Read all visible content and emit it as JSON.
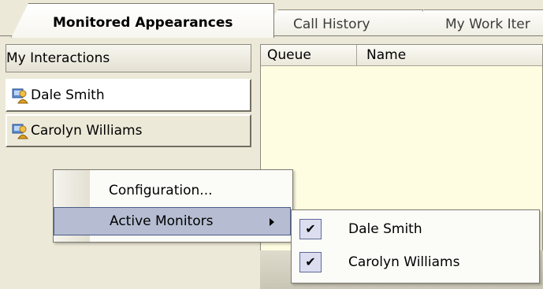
{
  "tabs": [
    {
      "label": "Monitored Appearances",
      "active": true
    },
    {
      "label": "Call History",
      "active": false
    },
    {
      "label": "My Work Iter",
      "active": false
    }
  ],
  "left_panel": {
    "header": "My Interactions",
    "items": [
      {
        "label": "Dale Smith",
        "icon": "user-monitor-icon",
        "selected": true
      },
      {
        "label": "Carolyn Williams",
        "icon": "user-monitor-icon",
        "selected": false
      }
    ]
  },
  "grid": {
    "columns": [
      "Queue",
      "Name"
    ]
  },
  "context_menu": {
    "items": [
      {
        "label": "Configuration..."
      },
      {
        "label": "Active Monitors",
        "has_submenu": true,
        "highlighted": true
      }
    ]
  },
  "submenu": {
    "items": [
      {
        "label": "Dale Smith",
        "checked": true
      },
      {
        "label": "Carolyn Williams",
        "checked": true
      }
    ],
    "check_glyph": "✔"
  },
  "colors": {
    "window_bg": "#ece9d8",
    "grid_bg": "#fefde1",
    "menu_highlight": "#b6bdd2",
    "menu_highlight_border": "#4b5b86"
  }
}
